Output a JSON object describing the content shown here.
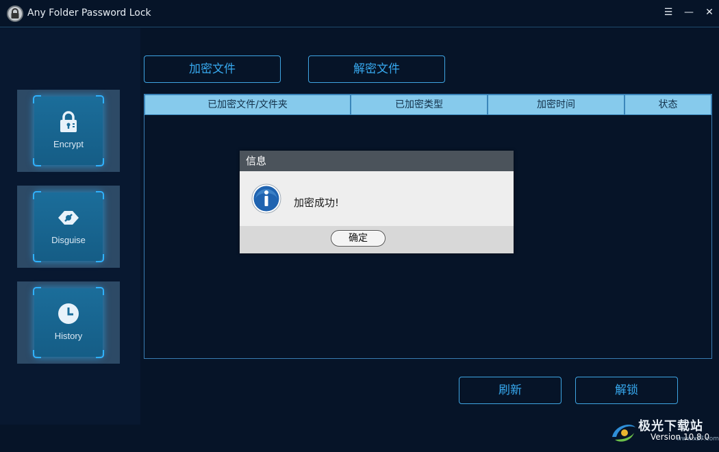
{
  "window": {
    "title": "Any Folder Password Lock",
    "menu_glyph": "☰",
    "minimize_glyph": "—",
    "close_glyph": "✕"
  },
  "sidebar": {
    "items": [
      {
        "label": "Encrypt",
        "icon": "padlock-icon"
      },
      {
        "label": "Disguise",
        "icon": "disguise-icon"
      },
      {
        "label": "History",
        "icon": "clock-icon"
      }
    ]
  },
  "toolbar": {
    "encrypt_file_label": "加密文件",
    "decrypt_file_label": "解密文件"
  },
  "table": {
    "columns": [
      "已加密文件/文件夹",
      "已加密类型",
      "加密时间",
      "状态"
    ],
    "rows": []
  },
  "dialog": {
    "title": "信息",
    "message": "加密成功!",
    "ok_label": "确定",
    "icon": "info-icon"
  },
  "actions": {
    "refresh_label": "刷新",
    "unlock_label": "解锁"
  },
  "footer": {
    "version": "Version 10.8.0",
    "watermark_text": "极光下载站",
    "watermark_url": "www.xz7.com"
  },
  "colors": {
    "background": "#061428",
    "accent": "#37a9ef",
    "table_header": "#86caec",
    "tile": "#2d4a66"
  }
}
